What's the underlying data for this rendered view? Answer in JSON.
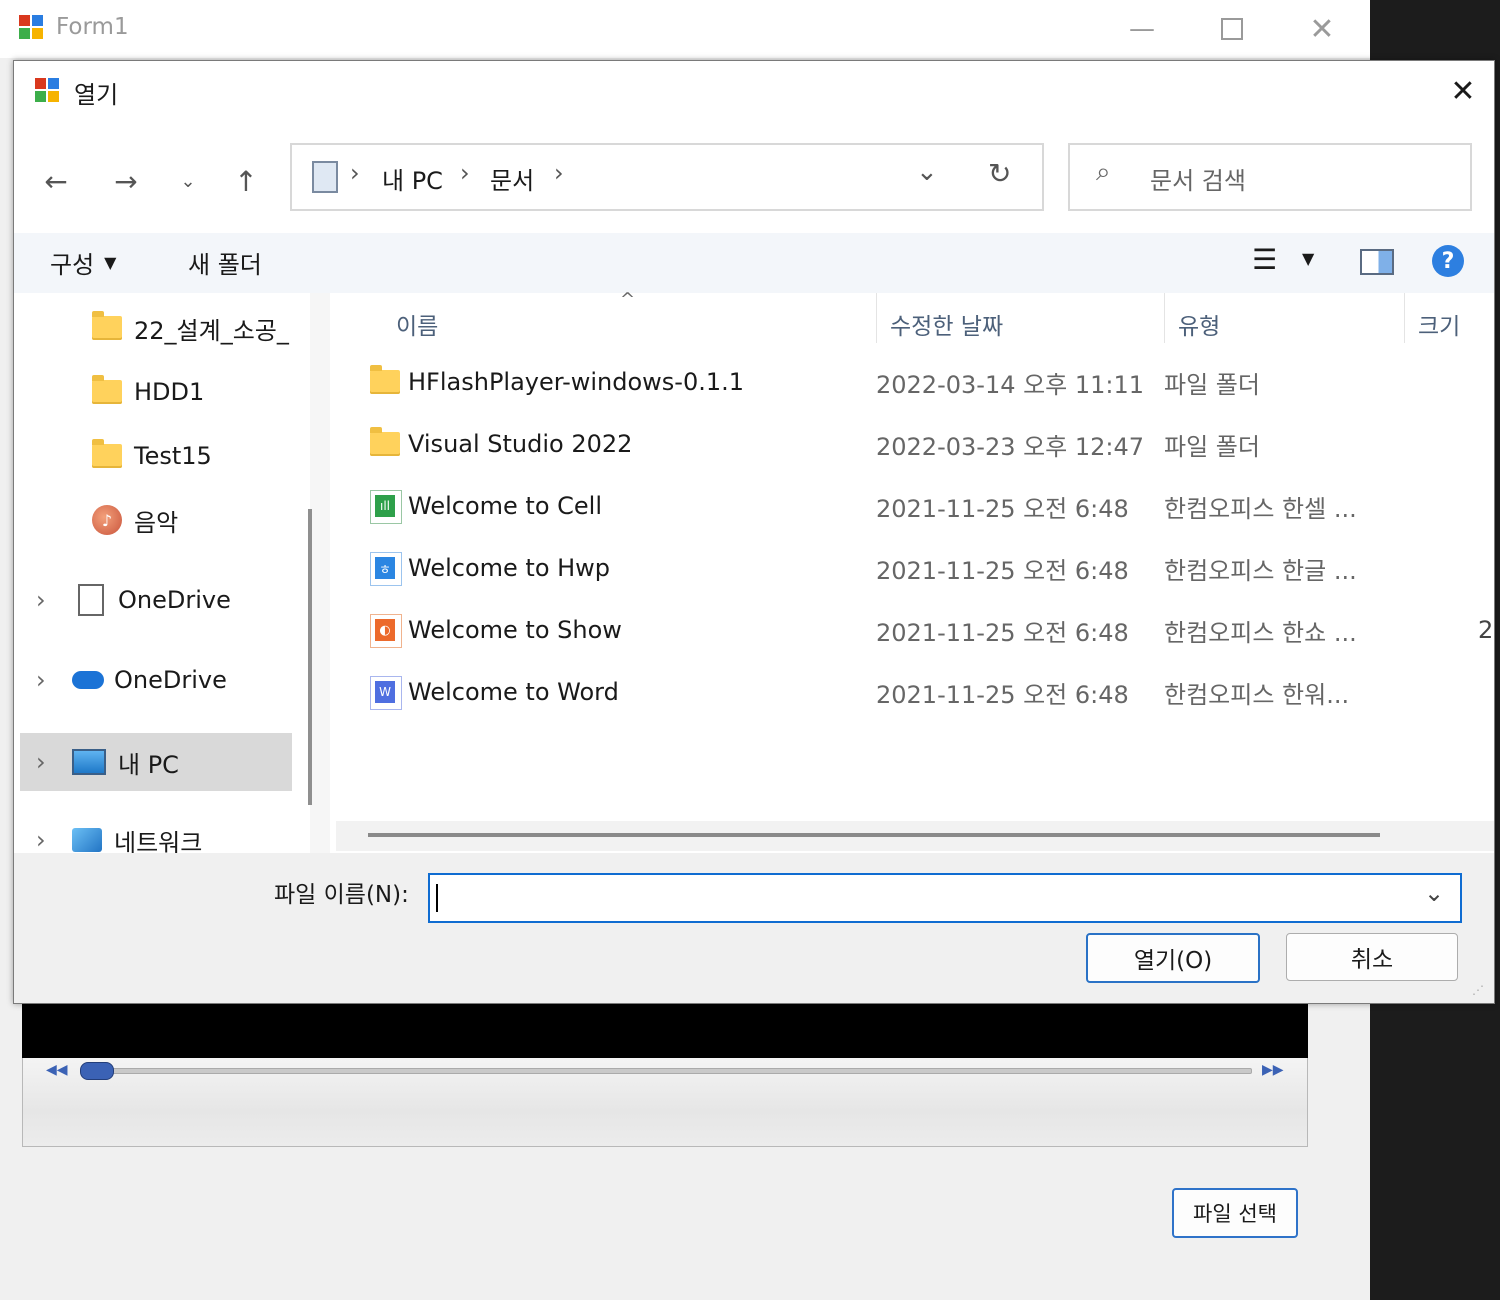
{
  "form": {
    "title": "Form1",
    "pick_button": "파일 선택"
  },
  "dialog": {
    "title": "열기",
    "breadcrumb": [
      "내 PC",
      "문서"
    ],
    "search_placeholder": "문서 검색",
    "toolbar": {
      "organize": "구성",
      "new_folder": "새 폴더"
    },
    "sidebar": [
      {
        "label": "22_설계_소공_"
      },
      {
        "label": "HDD1"
      },
      {
        "label": "Test15"
      },
      {
        "label": "음악"
      },
      {
        "label": "OneDrive"
      },
      {
        "label": "OneDrive"
      },
      {
        "label": "내 PC"
      },
      {
        "label": "네트워크"
      }
    ],
    "columns": {
      "name": "이름",
      "date": "수정한 날짜",
      "type": "유형",
      "size": "크기"
    },
    "files": [
      {
        "name": "HFlashPlayer-windows-0.1.1",
        "date": "2022-03-14 오후 11:11",
        "type": "파일 폴더",
        "size": "",
        "icon": "folder-icon"
      },
      {
        "name": "Visual Studio 2022",
        "date": "2022-03-23 오후 12:47",
        "type": "파일 폴더",
        "size": "",
        "icon": "folder-icon"
      },
      {
        "name": "Welcome to Cell",
        "date": "2021-11-25 오전 6:48",
        "type": "한컴오피스 한셀 ...",
        "size": "",
        "icon": "hancell-icon"
      },
      {
        "name": "Welcome to Hwp",
        "date": "2021-11-25 오전 6:48",
        "type": "한컴오피스 한글 ...",
        "size": "",
        "icon": "hwp-icon"
      },
      {
        "name": "Welcome to Show",
        "date": "2021-11-25 오전 6:48",
        "type": "한컴오피스 한쇼 ...",
        "size": "2",
        "icon": "hanshow-icon"
      },
      {
        "name": "Welcome to Word",
        "date": "2021-11-25 오전 6:48",
        "type": "한컴오피스 한워...",
        "size": "",
        "icon": "hanword-icon"
      }
    ],
    "filename_label": "파일 이름(N):",
    "filename_value": "",
    "open_button": "열기(O)",
    "cancel_button": "취소"
  }
}
